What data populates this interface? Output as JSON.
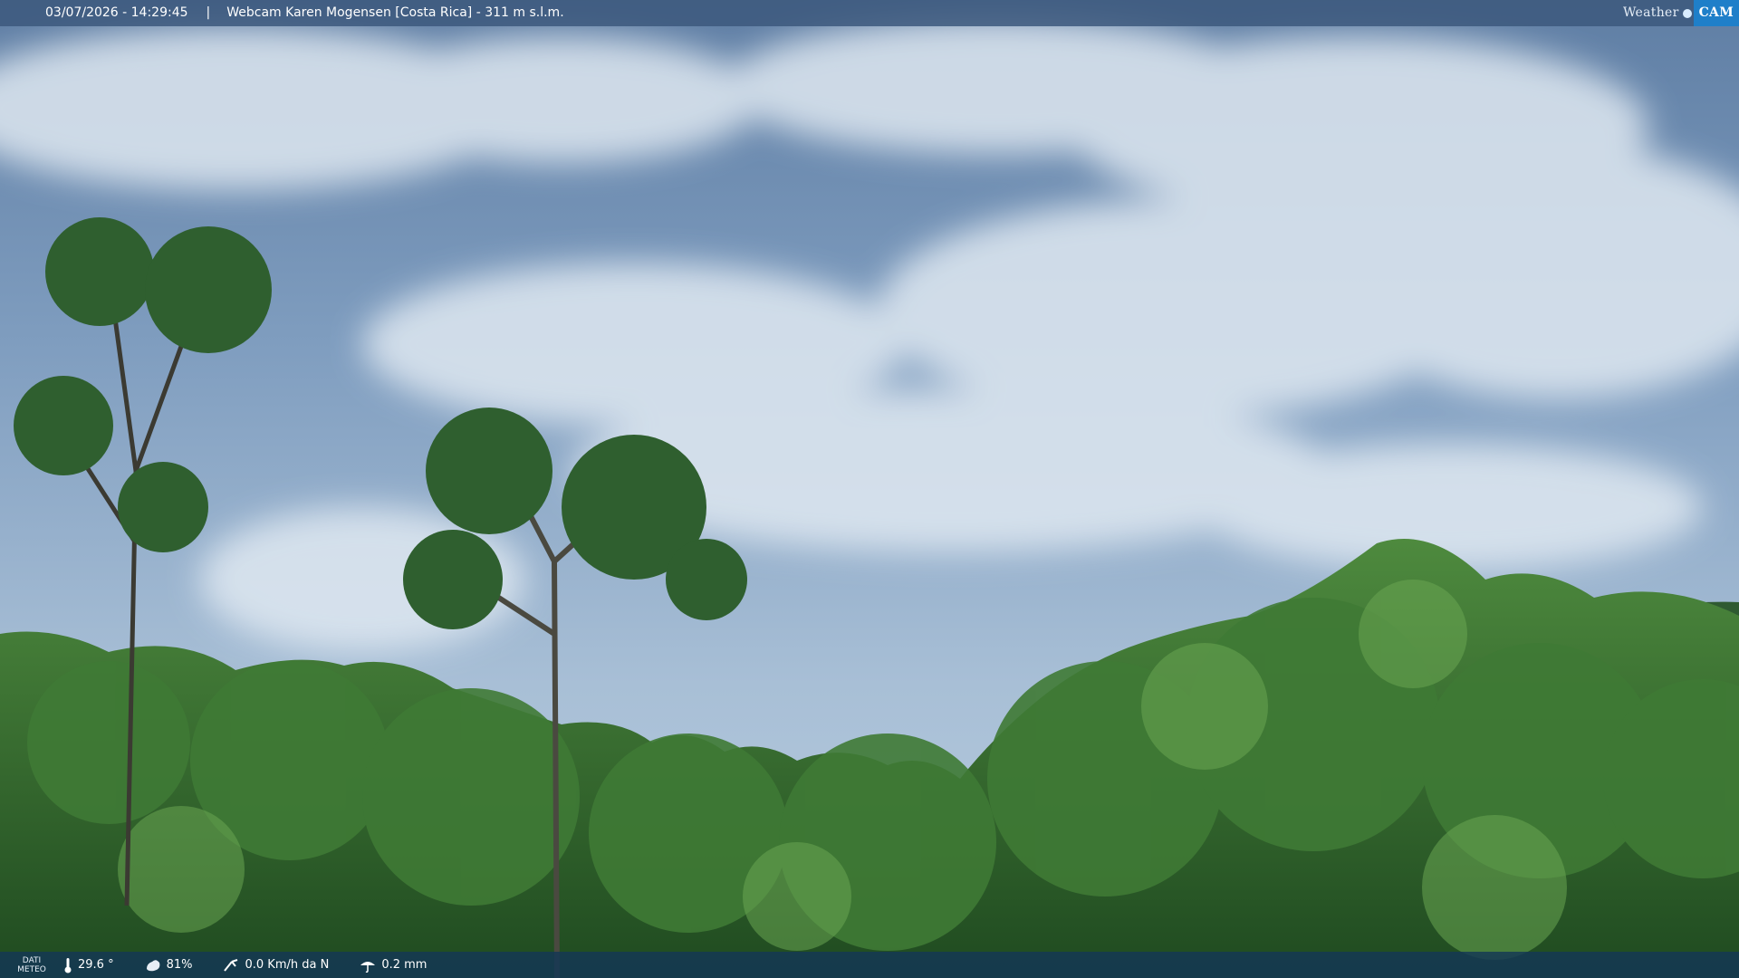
{
  "overlay": {
    "timestamp": "03/07/2026 - 14:29:45",
    "separator": "|",
    "title": "Webcam Karen Mogensen [Costa Rica] - 311 m s.l.m.",
    "brand_weather": "Weather",
    "brand_cam": "CAM"
  },
  "weather": {
    "label_line1": "DATI",
    "label_line2": "METEO",
    "temperature": "29.6 °",
    "humidity": "81%",
    "wind": "0.0 Km/h da N",
    "rain": "0.2 mm"
  },
  "icons": [
    "thermometer-icon",
    "humidity-icon",
    "wind-icon",
    "rain-icon"
  ],
  "colors": {
    "sky": "#6f8fb0",
    "top_bar": "#3c587d",
    "bottom_bar": "#143755",
    "brand_cam": "#1f7fc9",
    "foliage": "#2f6a2c"
  }
}
